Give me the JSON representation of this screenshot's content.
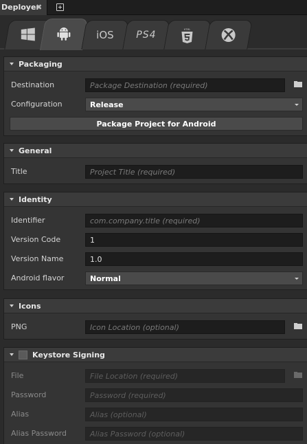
{
  "window": {
    "tab_title": "Deployer",
    "close_glyph": "✖"
  },
  "platforms": [
    {
      "name": "windows-icon"
    },
    {
      "name": "android-icon"
    },
    {
      "name": "ios-icon",
      "label": "iOS"
    },
    {
      "name": "ps4-icon",
      "label": "PS4"
    },
    {
      "name": "html5-icon",
      "label": "HTML"
    },
    {
      "name": "xbox-icon"
    }
  ],
  "packaging": {
    "title": "Packaging",
    "destination_label": "Destination",
    "destination_placeholder": "Package Destination (required)",
    "configuration_label": "Configuration",
    "configuration_value": "Release",
    "package_button": "Package Project for Android"
  },
  "general": {
    "title": "General",
    "title_label": "Title",
    "title_placeholder": "Project Title (required)"
  },
  "identity": {
    "title": "Identity",
    "identifier_label": "Identifier",
    "identifier_placeholder": "com.company.title (required)",
    "version_code_label": "Version Code",
    "version_code_value": "1",
    "version_name_label": "Version Name",
    "version_name_value": "1.0",
    "flavor_label": "Android flavor",
    "flavor_value": "Normal"
  },
  "icons": {
    "title": "Icons",
    "png_label": "PNG",
    "png_placeholder": "Icon Location (optional)"
  },
  "keystore": {
    "title": "Keystore Signing",
    "checked": false,
    "file_label": "File",
    "file_placeholder": "File Location (required)",
    "password_label": "Password",
    "password_placeholder": "Password (required)",
    "alias_label": "Alias",
    "alias_placeholder": "Alias (optional)",
    "alias_password_label": "Alias Password",
    "alias_password_placeholder": "Alias Password (optional)"
  },
  "colors": {
    "background": "#2b2b2b",
    "panel": "#343434",
    "field": "#1d1d1d",
    "accent_text": "#e8e8e8"
  }
}
